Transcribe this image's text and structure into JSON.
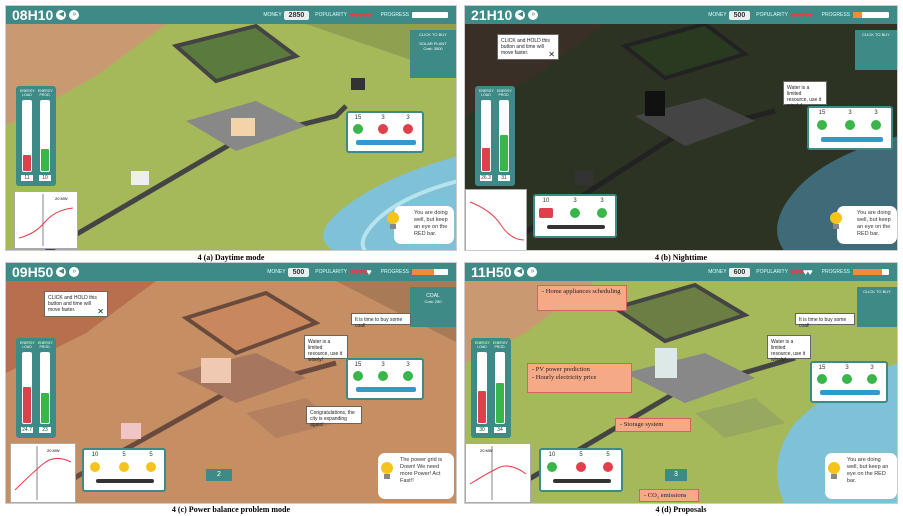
{
  "hud": {
    "money_label": "MONEY",
    "popularity_label": "POPULARITY",
    "progress_label": "PROGRESS"
  },
  "panels": [
    {
      "id": "a",
      "clock": "08H10",
      "money": "2850",
      "caption": "4 (a) Daytime mode",
      "load": "11",
      "prod": "10",
      "load_fill": 0.25,
      "prod_fill": 0.35,
      "res": [
        "15",
        "3",
        "3"
      ],
      "tip": "You are doing well, but keep an eye on the RED bar.",
      "buy_title": "CLICK TO BUY",
      "buy_item": "SOLAR PLANT",
      "buy_cost": "Cost: 3500",
      "progress": 0.0
    },
    {
      "id": "b",
      "clock": "21H10",
      "money": "500",
      "caption": "4 (b) Nighttime",
      "load": "26.3",
      "prod": "31",
      "load_fill": 0.35,
      "prod_fill": 0.55,
      "res": [
        "15",
        "3",
        "3"
      ],
      "res2": [
        "10",
        "3",
        "3"
      ],
      "tip": "You are doing well, but keep an eye on the RED bar.",
      "hold": "CLICK and HOLD this button and time will move faster.",
      "water": "Water is a limited resource, use it wisely!",
      "buy_title": "CLICK TO BUY",
      "progress": 0.25
    },
    {
      "id": "c",
      "clock": "09H50",
      "money": "500",
      "caption": "4 (c) Power balance problem mode",
      "load": "24.7",
      "prod": "23",
      "load_fill": 0.55,
      "prod_fill": 0.45,
      "res": [
        "15",
        "3",
        "3"
      ],
      "res2": [
        "10",
        "5",
        "5"
      ],
      "tip": "The power grid is Down! We need more Power! Act Fast!!",
      "hold": "CLICK and HOLD this button and time will move faster.",
      "water": "Water is a limited resource, use it wisely!",
      "coal": "It is time to buy some coal!",
      "congrats": "Congratulations, the city is expanding again!",
      "buy_item": "COAL",
      "buy_cost": "Cost: 250",
      "count": "2",
      "progress": 0.6
    },
    {
      "id": "d",
      "clock": "11H50",
      "money": "600",
      "caption": "4 (d) Proposals",
      "load": "30",
      "prod": "34",
      "load_fill": 0.45,
      "prod_fill": 0.6,
      "res": [
        "15",
        "3",
        "3"
      ],
      "res2": [
        "10",
        "5",
        "5"
      ],
      "tip": "You are doing well, but keep an eye on the RED bar.",
      "water": "Water is a limited resource, use it wisely!",
      "coal": "It is time to buy some coal!",
      "count": "3",
      "buy_title": "CLICK TO BUY",
      "progress": 0.8,
      "callouts": [
        "- Home appliances scheduling",
        "- PV power prediction\n- Hourly electricity price",
        "- Storage system",
        "- CO₂ emissions"
      ]
    }
  ],
  "meter_labels": {
    "load": "ENERGY LOAD",
    "prod": "ENERGY PROD."
  },
  "graph_label": "20 MW",
  "colors": {
    "hud": "#3d8a86",
    "grass": "#a5b85a",
    "dark": "#2d3322",
    "warm": "#d6a87c",
    "red": "#e0404b",
    "green": "#39b54a"
  }
}
